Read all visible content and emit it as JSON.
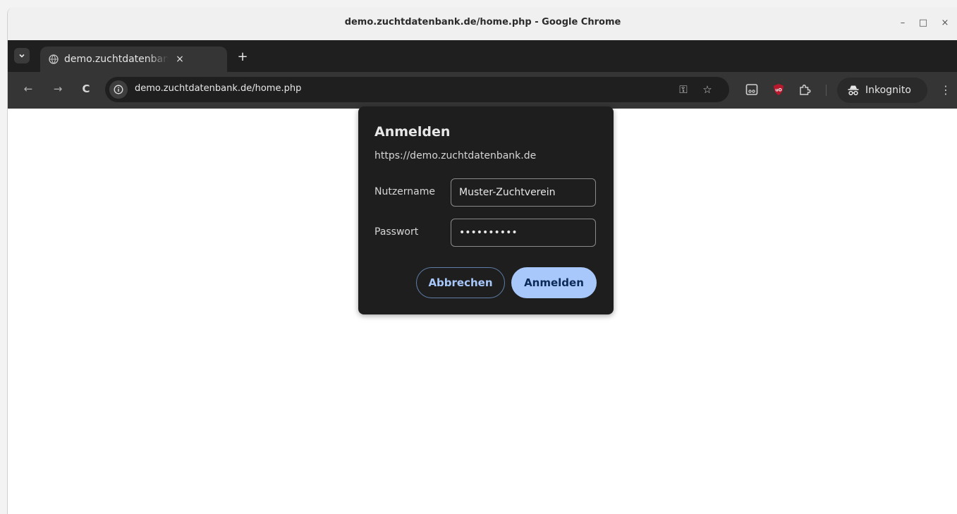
{
  "window": {
    "title": "demo.zuchtdatenbank.de/home.php - Google Chrome",
    "minimize_glyph": "–",
    "maximize_glyph": "□",
    "close_glyph": "×"
  },
  "tabs": [
    {
      "title": "demo.zuchtdatenbank.de/home.php",
      "close_glyph": "×",
      "favicon": "globe-icon"
    }
  ],
  "new_tab_glyph": "+",
  "toolbar": {
    "back_glyph": "←",
    "forward_glyph": "→",
    "reload_glyph": "C",
    "url": "demo.zuchtdatenbank.de/home.php",
    "key_glyph": "⚿",
    "star_glyph": "☆",
    "extensions": [
      "reader-extension-icon",
      "ublock-icon",
      "puzzle-extensions-icon"
    ],
    "profile_label": "Inkognito",
    "menu_glyph": "⋮"
  },
  "dialog": {
    "title": "Anmelden",
    "origin": "https://demo.zuchtdatenbank.de",
    "username_label": "Nutzername",
    "username_value": "Muster-Zuchtverein",
    "password_label": "Passwort",
    "password_value": "••••••••••",
    "cancel_label": "Abbrechen",
    "submit_label": "Anmelden"
  },
  "colors": {
    "accent": "#a8c7fa",
    "dialog_bg": "#1e1e1e",
    "toolbar_bg": "#353535"
  }
}
